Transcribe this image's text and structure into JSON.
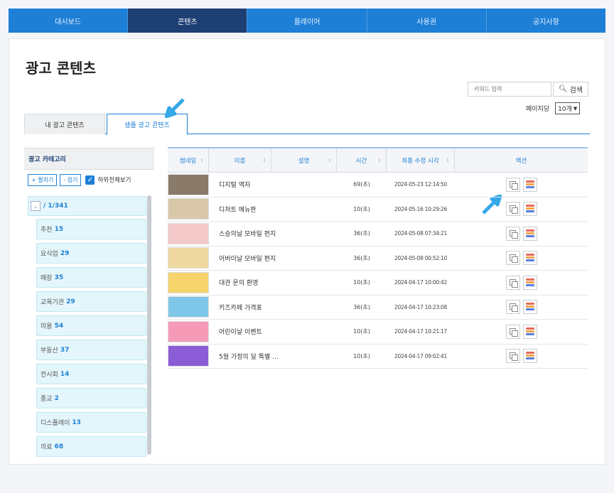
{
  "nav": {
    "items": [
      {
        "label": "대시보드",
        "active": false
      },
      {
        "label": "콘텐츠",
        "active": true
      },
      {
        "label": "플레이어",
        "active": false
      },
      {
        "label": "사용권",
        "active": false
      },
      {
        "label": "공지사항",
        "active": false
      }
    ]
  },
  "page": {
    "title": "광고 콘텐츠"
  },
  "search": {
    "placeholder": "키워드 입력",
    "button_label": "검색"
  },
  "per_page": {
    "label": "페이지당",
    "value": "10개"
  },
  "tabs": [
    {
      "label": "내 광고 콘텐츠",
      "active": false
    },
    {
      "label": "샘플 광고 콘텐츠",
      "active": true
    }
  ],
  "sidebar": {
    "title": "광고 카테고리",
    "expand_label": "+ 펼치기",
    "collapse_label": "- 접기",
    "show_all_label": "하위전체보기",
    "root_label": "/ 1/341",
    "categories": [
      {
        "name": "추천",
        "count": "15"
      },
      {
        "name": "요식업",
        "count": "29"
      },
      {
        "name": "매장",
        "count": "35"
      },
      {
        "name": "교육기관",
        "count": "29"
      },
      {
        "name": "미용",
        "count": "54"
      },
      {
        "name": "부동산",
        "count": "37"
      },
      {
        "name": "전시회",
        "count": "14"
      },
      {
        "name": "종교",
        "count": "2"
      },
      {
        "name": "디스플레이",
        "count": "13"
      },
      {
        "name": "의료",
        "count": "68"
      }
    ]
  },
  "table": {
    "headers": {
      "thumbnail": "썸네일",
      "name": "이름",
      "description": "설명",
      "time": "시간",
      "modified": "최종 수정 시각",
      "action": "액션"
    },
    "rows": [
      {
        "name": "디지털 액자",
        "time": "69(초)",
        "modified": "2024-05-23 12:14:50",
        "thumb_color": "#8a7a6a"
      },
      {
        "name": "디저트 메뉴판",
        "time": "10(초)",
        "modified": "2024-05-16 10:29:26",
        "thumb_color": "#d9c7a9"
      },
      {
        "name": "스승의날 모바일 편지",
        "time": "36(초)",
        "modified": "2024-05-08 07:34:21",
        "thumb_color": "#f3c9c9"
      },
      {
        "name": "어버이날 모바일 편지",
        "time": "36(초)",
        "modified": "2024-05-08 00:52:10",
        "thumb_color": "#f0d9a0"
      },
      {
        "name": "대관 문의 환영",
        "time": "10(초)",
        "modified": "2024-04-17 10:00:42",
        "thumb_color": "#f6d36b"
      },
      {
        "name": "키즈카페 가격표",
        "time": "36(초)",
        "modified": "2024-04-17 10:23:08",
        "thumb_color": "#7fc7e8"
      },
      {
        "name": "어린이날 이벤트",
        "time": "10(초)",
        "modified": "2024-04-17 10:21:17",
        "thumb_color": "#f59bb8"
      },
      {
        "name": "5월 가정의 달 특별 ...",
        "time": "10(초)",
        "modified": "2024-04-17 09:02:41",
        "thumb_color": "#8a5cd6"
      }
    ]
  },
  "colors": {
    "primary": "#1e7fd6",
    "nav_active": "#1d3f73",
    "category_bg": "#e3f6fb",
    "annotation_arrow": "#35a8e8"
  }
}
